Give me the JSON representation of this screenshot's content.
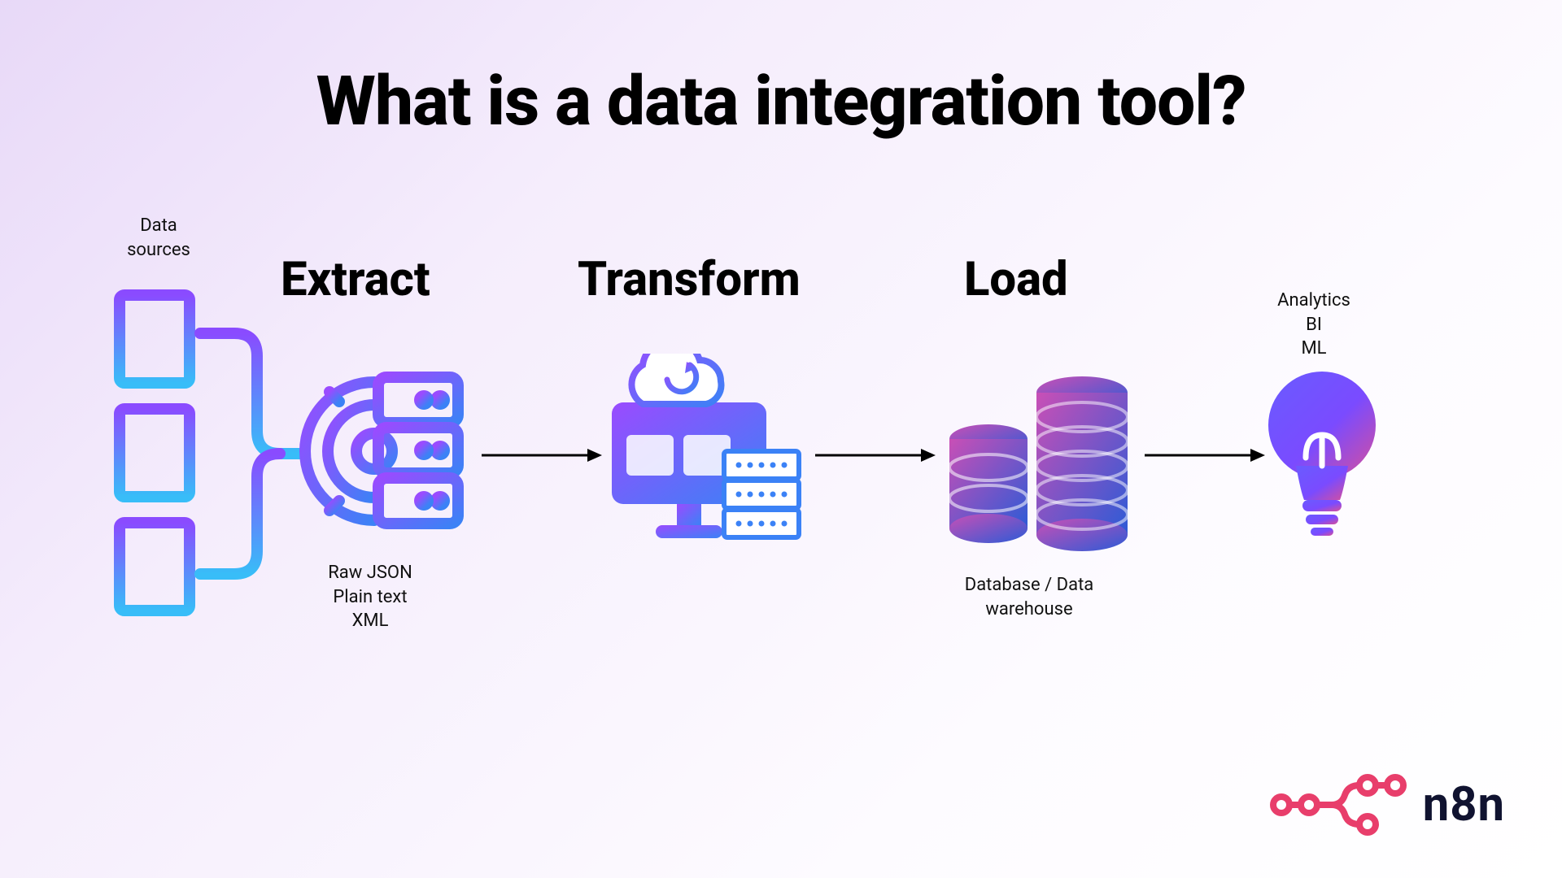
{
  "title": "What is a data integration tool?",
  "stages": {
    "extract": "Extract",
    "transform": "Transform",
    "load": "Load"
  },
  "labels": {
    "data_sources": "Data\nsources",
    "extract_caption": "Raw JSON\nPlain text\nXML",
    "load_caption": "Database / Data\nwarehouse",
    "analytics_caption": "Analytics\nBI\nML"
  },
  "brand": "n8n",
  "colors": {
    "purple": "#8a4bff",
    "blue": "#3b82f6",
    "cyan": "#38bdf8",
    "pink": "#c94fb6",
    "darkblue": "#2d5bd6",
    "brand_pink": "#e83e6b"
  }
}
